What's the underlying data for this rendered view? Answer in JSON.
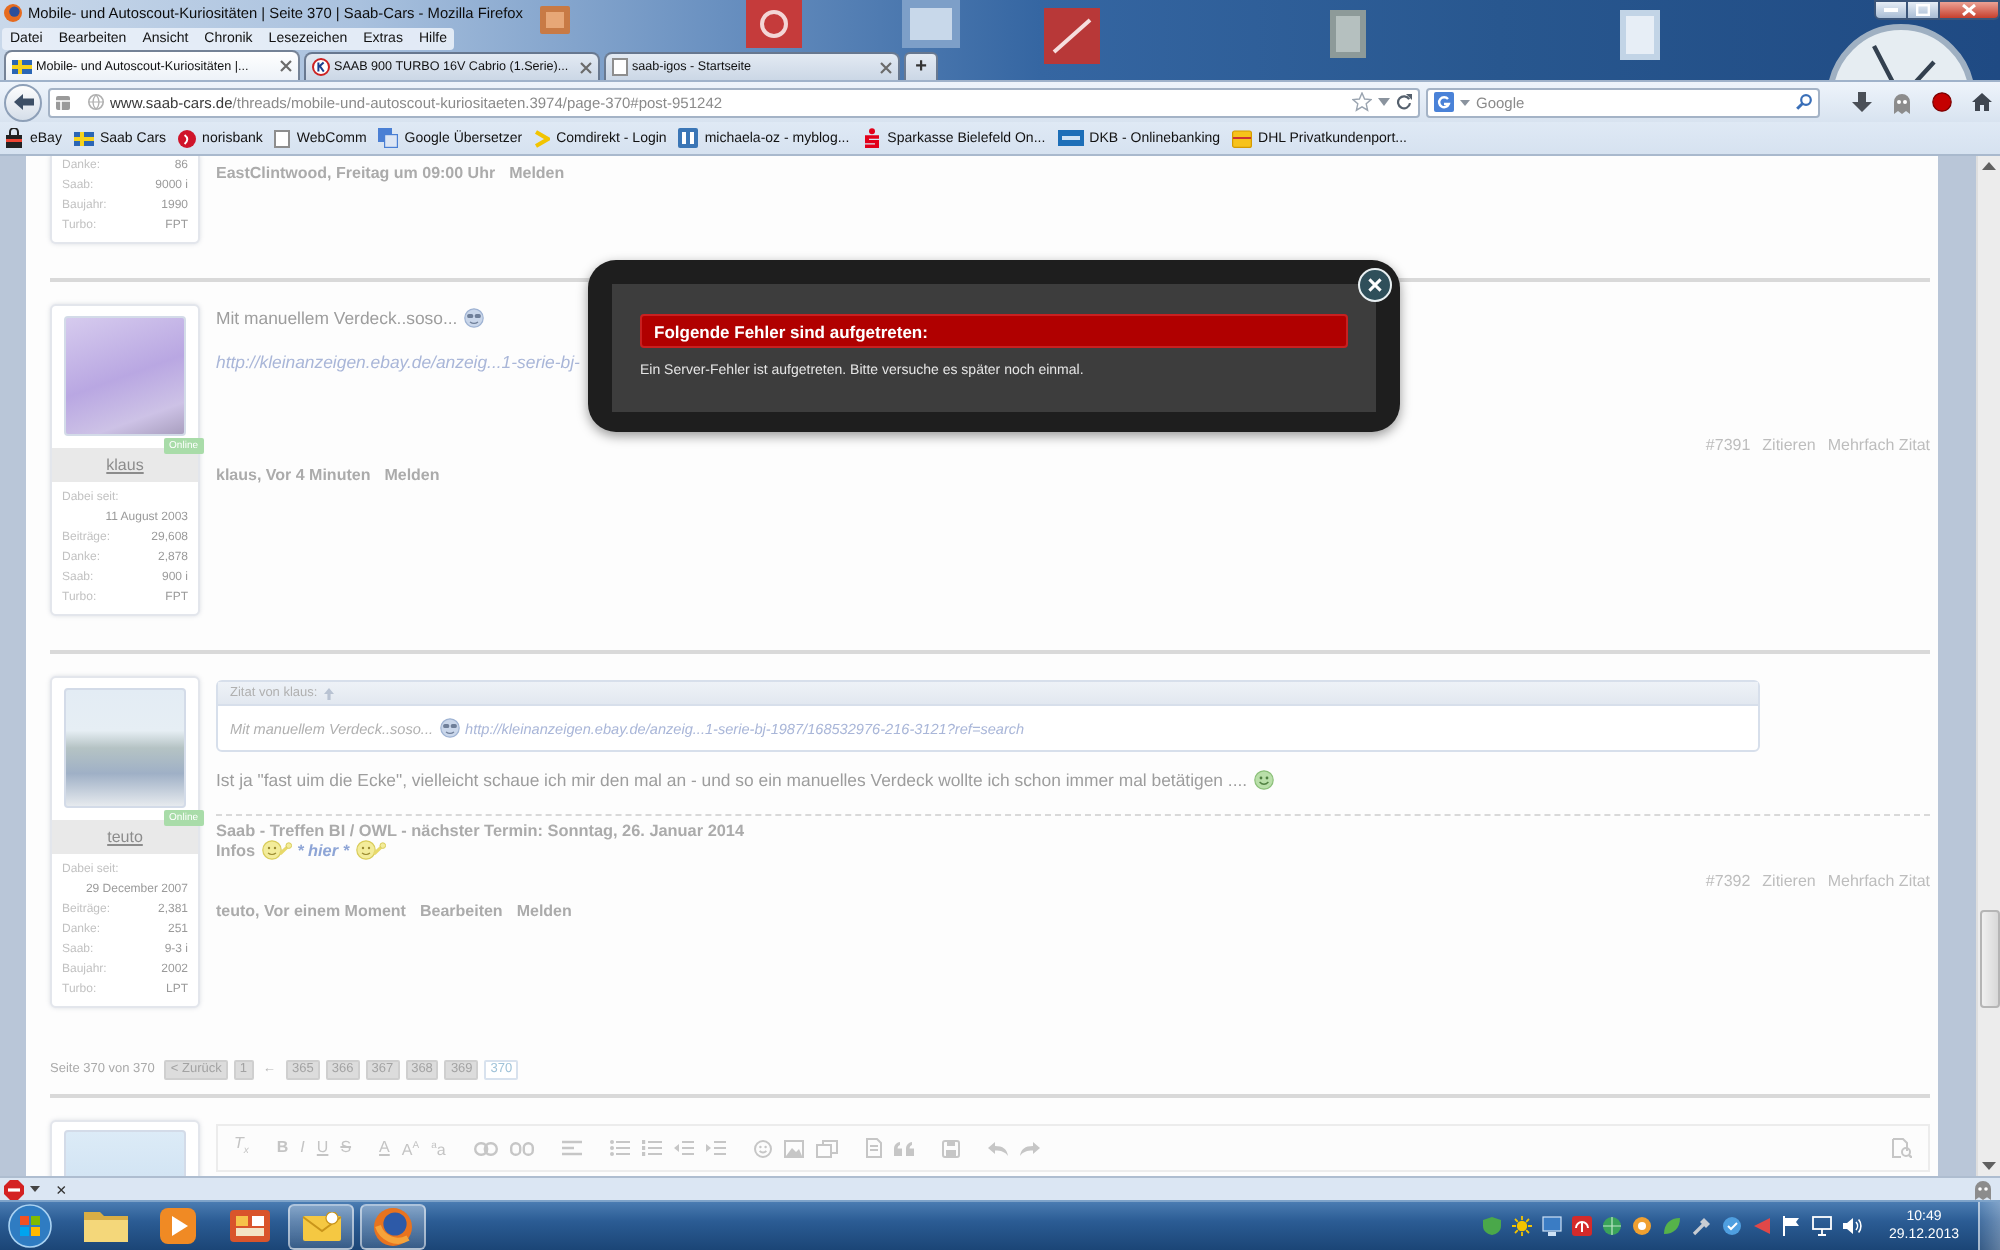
{
  "window": {
    "title": "Mobile- und Autoscout-Kuriositäten | Seite 370 | Saab-Cars - Mozilla Firefox"
  },
  "menu": [
    "Datei",
    "Bearbeiten",
    "Ansicht",
    "Chronik",
    "Lesezeichen",
    "Extras",
    "Hilfe"
  ],
  "tabs": [
    {
      "label": "Mobile- und Autoscout-Kuriositäten |...",
      "selected": true
    },
    {
      "label": "SAAB 900 TURBO 16V Cabrio (1.Serie)...",
      "selected": false
    },
    {
      "label": "saab-igos - Startseite",
      "selected": false
    }
  ],
  "new_tab": "+",
  "address": {
    "host": "www.saab-cars.de",
    "path": "/threads/mobile-und-autoscout-kuriositaeten.3974/page-370#post-951242"
  },
  "search": {
    "placeholder": "Google"
  },
  "bookmarks": [
    "eBay",
    "Saab Cars",
    "norisbank",
    "WebComm",
    "Google Übersetzer",
    "Comdirekt - Login",
    "michaela-oz - myblog...",
    "Sparkasse Bielefeld On...",
    "DKB - Onlinebanking",
    "DHL Privatkundenport..."
  ],
  "posts": [
    {
      "stats": [
        {
          "label": "Danke:",
          "value": "86",
          "kind": "inline"
        },
        {
          "label": "Saab:",
          "value": "9000 i",
          "kind": "inline"
        },
        {
          "label": "Baujahr:",
          "value": "1990",
          "kind": "inline"
        },
        {
          "label": "Turbo:",
          "value": "FPT",
          "kind": "inline"
        }
      ],
      "byline": "EastClintwood, Freitag um 09:00 Uhr",
      "actions": [
        "Melden"
      ]
    },
    {
      "user": "klaus",
      "status": "Online",
      "stats": [
        {
          "label": "Dabei seit:",
          "value": "11 August 2003",
          "kind": "stacked"
        },
        {
          "label": "Beiträge:",
          "value": "29,608",
          "kind": "inline"
        },
        {
          "label": "Danke:",
          "value": "2,878",
          "kind": "inline"
        },
        {
          "label": "Saab:",
          "value": "900 i",
          "kind": "inline"
        },
        {
          "label": "Turbo:",
          "value": "FPT",
          "kind": "inline"
        }
      ],
      "body": [
        {
          "parts": [
            {
              "kind": "text",
              "text": "Mit manuellem Verdeck..soso..."
            },
            {
              "kind": "cool"
            }
          ]
        },
        {
          "parts": [
            {
              "kind": "link",
              "text": "http://kleinanzeigen.ebay.de/anzeig...1-serie-bj-"
            }
          ]
        }
      ],
      "number": "#7391",
      "tools": [
        "Zitieren",
        "Mehrfach Zitat"
      ],
      "byline": "klaus, Vor 4 Minuten",
      "actions": [
        "Melden"
      ]
    },
    {
      "user": "teuto",
      "status": "Online",
      "stats": [
        {
          "label": "Dabei seit:",
          "value": "29 December 2007",
          "kind": "stacked"
        },
        {
          "label": "Beiträge:",
          "value": "2,381",
          "kind": "inline"
        },
        {
          "label": "Danke:",
          "value": "251",
          "kind": "inline"
        },
        {
          "label": "Saab:",
          "value": "9-3 i",
          "kind": "inline"
        },
        {
          "label": "Baujahr:",
          "value": "2002",
          "kind": "inline"
        },
        {
          "label": "Turbo:",
          "value": "LPT",
          "kind": "inline"
        }
      ],
      "quote": {
        "header": "Zitat von klaus:",
        "parts": [
          {
            "kind": "text",
            "text": "Mit manuellem Verdeck..soso..."
          },
          {
            "kind": "cool"
          },
          {
            "kind": "link",
            "text": "http://kleinanzeigen.ebay.de/anzeig...1-serie-bj-1987/168532976-216-3121?ref=search"
          }
        ]
      },
      "body": [
        {
          "parts": [
            {
              "kind": "text",
              "text": "Ist ja \"fast uim die Ecke\", vielleicht schaue ich mir den mal an - und so ein manuelles Verdeck wollte ich schon immer mal betätigen ...."
            },
            {
              "kind": "grin"
            }
          ]
        }
      ],
      "signature": [
        {
          "parts": [
            {
              "kind": "bold",
              "text": "Saab - Treffen BI / OWL - nächster Termin: Sonntag, 26. Januar 2014"
            }
          ]
        },
        {
          "parts": [
            {
              "kind": "bold",
              "text": "Infos"
            },
            {
              "kind": "wave"
            },
            {
              "kind": "boldlink",
              "text": "* hier *"
            },
            {
              "kind": "wave"
            }
          ]
        }
      ],
      "number": "#7392",
      "tools": [
        "Zitieren",
        "Mehrfach Zitat"
      ],
      "byline": "teuto, Vor einem Moment",
      "actions": [
        "Bearbeiten",
        "Melden"
      ]
    }
  ],
  "pagination": {
    "summary": "Seite 370 von 370",
    "previous": "< Zurück",
    "first_page": {
      "label": "1",
      "selected": false
    },
    "jump": "←",
    "pages": [
      {
        "label": "365",
        "selected": false
      },
      {
        "label": "366",
        "selected": false
      },
      {
        "label": "367",
        "selected": false
      },
      {
        "label": "368",
        "selected": false
      },
      {
        "label": "369",
        "selected": false
      },
      {
        "label": "370",
        "selected": true
      }
    ]
  },
  "editor": {
    "tools": [
      {
        "kind": "clear",
        "text": "T$_{x}$"
      },
      {
        "kind": "bold",
        "text": "B"
      },
      {
        "kind": "italic",
        "text": "I"
      },
      {
        "kind": "underline",
        "text": "U"
      },
      {
        "kind": "strike",
        "text": "S"
      },
      {
        "kind": "color",
        "text": "A"
      },
      {
        "kind": "size",
        "text": "A$^{A}$"
      },
      {
        "kind": "font",
        "text": "$^{a}$a"
      },
      {
        "kind": "link"
      },
      {
        "kind": "unlink"
      },
      {
        "kind": "align"
      },
      {
        "kind": "bullets"
      },
      {
        "kind": "numbers"
      },
      {
        "kind": "outdent"
      },
      {
        "kind": "indent"
      },
      {
        "kind": "smiley"
      },
      {
        "kind": "image"
      },
      {
        "kind": "media"
      },
      {
        "kind": "code"
      },
      {
        "kind": "quote"
      },
      {
        "kind": "save"
      },
      {
        "kind": "undo"
      },
      {
        "kind": "redo"
      },
      {
        "kind": "preview"
      }
    ]
  },
  "dialog": {
    "title": "Folgende Fehler sind aufgetreten:",
    "message": "Ein Server-Fehler ist aufgetreten. Bitte versuche es später noch einmal."
  },
  "addon_bar": {
    "close": "×"
  },
  "taskbar": {
    "apps": [
      {
        "kind": "folder",
        "running": false
      },
      {
        "kind": "player",
        "running": false
      },
      {
        "kind": "office",
        "running": false
      },
      {
        "kind": "mail",
        "running": true
      },
      {
        "kind": "browser",
        "running": true
      }
    ],
    "time": "10:49",
    "date": "29.12.2013"
  }
}
